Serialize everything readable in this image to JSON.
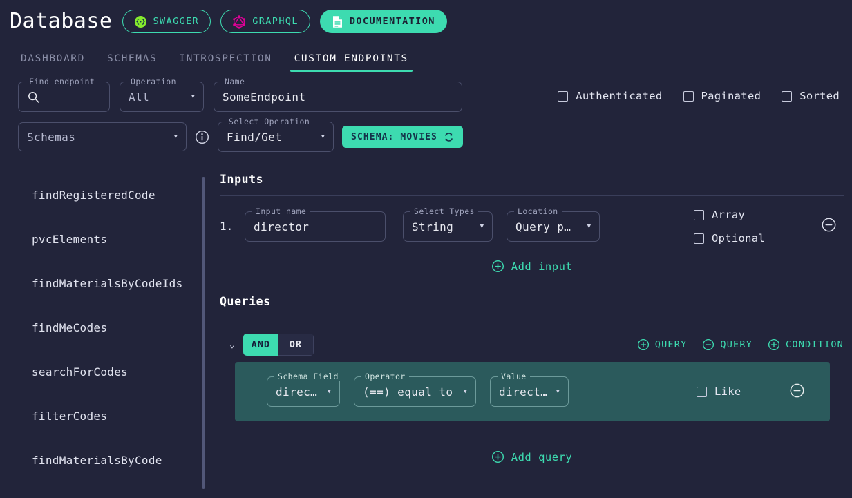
{
  "header": {
    "title": "Database",
    "buttons": [
      {
        "label": "SWAGGER",
        "icon": "swagger-icon",
        "style": "outline"
      },
      {
        "label": "GRAPHQL",
        "icon": "graphql-icon",
        "style": "outline"
      },
      {
        "label": "DOCUMENTATION",
        "icon": "document-icon",
        "style": "filled"
      }
    ]
  },
  "tabs": [
    {
      "label": "DASHBOARD",
      "active": false
    },
    {
      "label": "SCHEMAS",
      "active": false
    },
    {
      "label": "INTROSPECTION",
      "active": false
    },
    {
      "label": "CUSTOM ENDPOINTS",
      "active": true
    }
  ],
  "topform": {
    "find_endpoint": {
      "label": "Find endpoint",
      "value": "",
      "icon": "search-icon"
    },
    "operation": {
      "label": "Operation",
      "value": "All"
    },
    "name": {
      "label": "Name",
      "value": "SomeEndpoint"
    },
    "schemas": {
      "label": "",
      "value": "Schemas"
    },
    "info_icon": "info-icon",
    "select_operation": {
      "label": "Select Operation",
      "value": "Find/Get"
    },
    "schema_chip": {
      "label": "SCHEMA: MOVIES",
      "icon": "refresh-icon"
    },
    "toggles": [
      {
        "label": "Authenticated",
        "checked": false
      },
      {
        "label": "Paginated",
        "checked": false
      },
      {
        "label": "Sorted",
        "checked": false
      }
    ]
  },
  "sidebar": {
    "items": [
      {
        "label": "findRegisteredCode"
      },
      {
        "label": "pvcElements"
      },
      {
        "label": "findMaterialsByCodeIds"
      },
      {
        "label": "findMeCodes"
      },
      {
        "label": "searchForCodes"
      },
      {
        "label": "filterCodes"
      },
      {
        "label": "findMaterialsByCode"
      }
    ]
  },
  "inputs_section": {
    "title": "Inputs",
    "rows": [
      {
        "index": "1.",
        "input_name": {
          "label": "Input name",
          "value": "director"
        },
        "types": {
          "label": "Select Types",
          "value": "String"
        },
        "location": {
          "label": "Location",
          "value": "Query p…"
        },
        "array": {
          "label": "Array",
          "checked": false
        },
        "optional": {
          "label": "Optional",
          "checked": false
        },
        "remove_icon": "minus-circle-icon"
      }
    ],
    "add_label": "Add input",
    "add_icon": "plus-circle-icon"
  },
  "queries_section": {
    "title": "Queries",
    "collapse_icon": "chevron-down-icon",
    "operator_and": "AND",
    "operator_or": "OR",
    "selected_operator": "AND",
    "actions": [
      {
        "label": "QUERY",
        "icon": "plus-circle-icon"
      },
      {
        "label": "QUERY",
        "icon": "minus-circle-icon"
      },
      {
        "label": "CONDITION",
        "icon": "plus-circle-icon"
      }
    ],
    "conditions": [
      {
        "schema_field": {
          "label": "Schema Field",
          "value": "direct…"
        },
        "operator": {
          "label": "Operator",
          "value": "(==) equal to"
        },
        "value": {
          "label": "Value",
          "value": "direct…"
        },
        "like": {
          "label": "Like",
          "checked": false
        },
        "remove_icon": "minus-circle-icon"
      }
    ],
    "add_label": "Add query",
    "add_icon": "plus-circle-icon"
  },
  "colors": {
    "background": "#22243a",
    "accent": "#3ddbb0",
    "graphql_pink": "#e10098",
    "swagger_green": "#85ea2d",
    "condition_bg": "#2b5a5c",
    "border": "#4b4f6b"
  }
}
